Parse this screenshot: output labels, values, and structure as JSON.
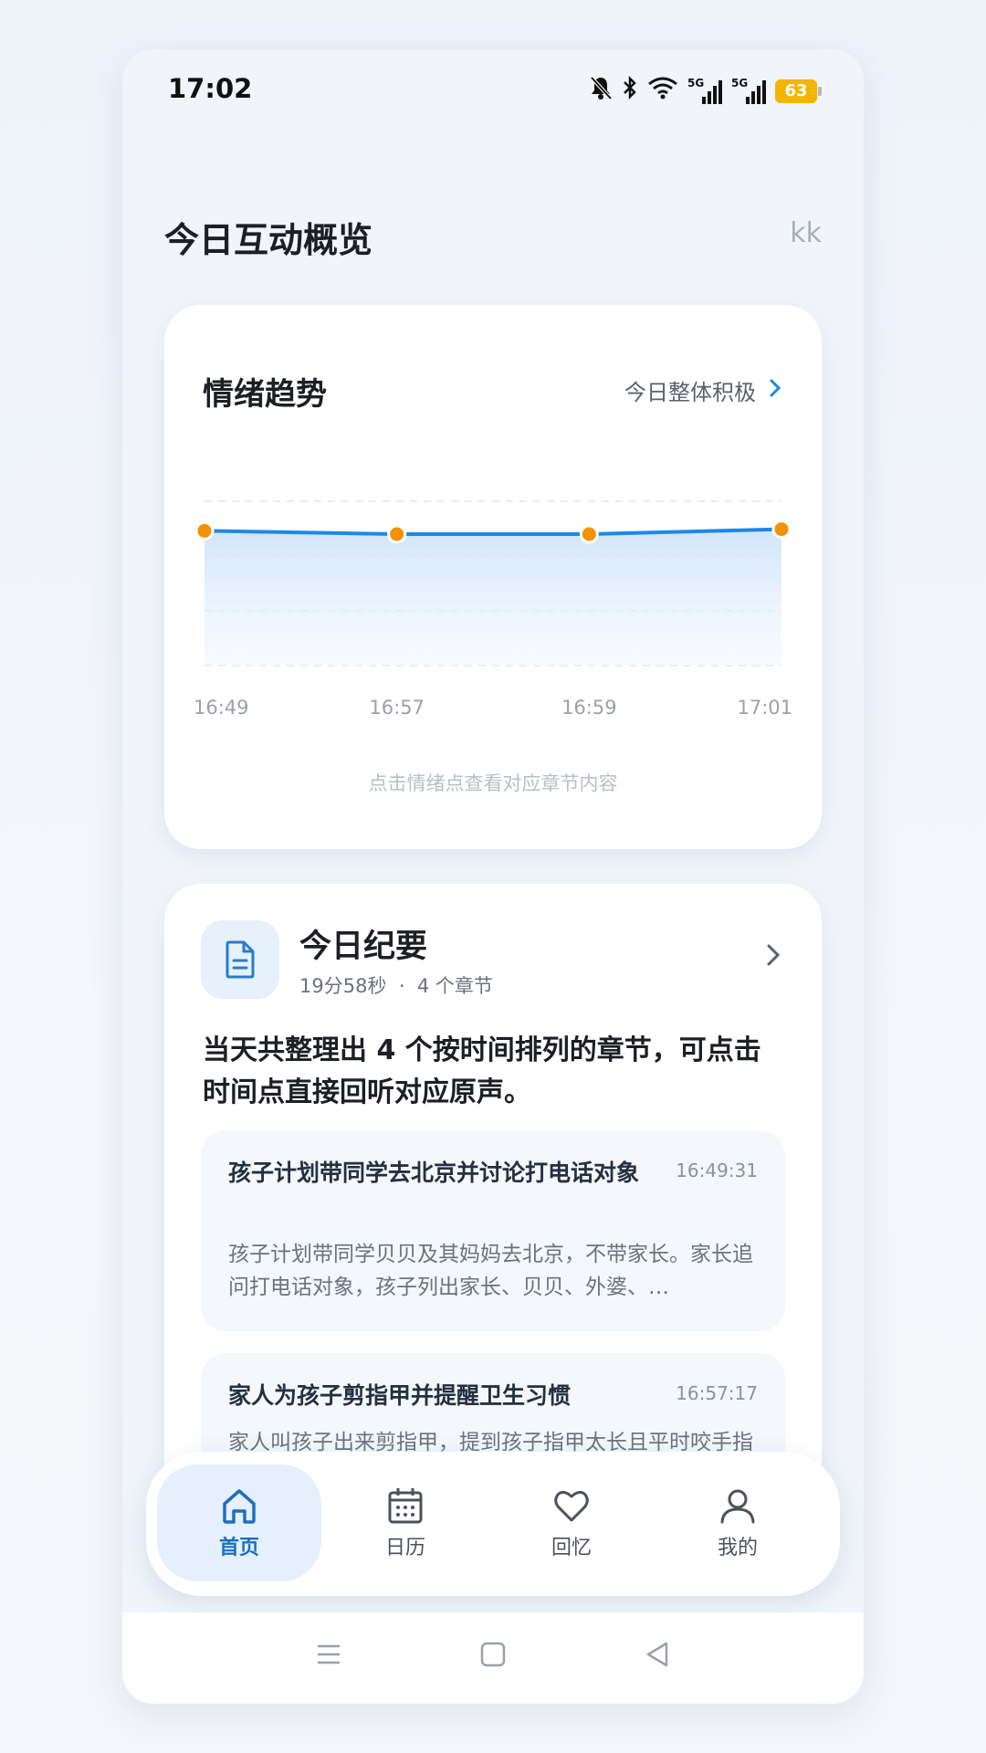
{
  "status_bar": {
    "time": "17:02",
    "battery": "63",
    "network_tag_1": "5G",
    "network_tag_2": "5G",
    "icons": [
      "bell-off-icon",
      "bluetooth-icon",
      "wifi-icon",
      "signal-5g-icon",
      "signal-5g-icon",
      "battery-icon"
    ]
  },
  "header": {
    "title": "今日互动概览",
    "user": "kk"
  },
  "mood_card": {
    "title": "情绪趋势",
    "summary": "今日整体积极",
    "hint": "点击情绪点查看对应章节内容",
    "line_color": "#1e88e5",
    "point_color": "#f39200"
  },
  "chart_data": {
    "type": "line",
    "x": [
      "16:49",
      "16:57",
      "16:59",
      "17:01"
    ],
    "series": [
      {
        "values": [
          0.82,
          0.8,
          0.8,
          0.83
        ]
      }
    ],
    "ylim": [
      0,
      1
    ],
    "grid": true
  },
  "summary_card": {
    "title": "今日纪要",
    "duration": "19分58秒",
    "separator": "·",
    "chapters_count": "4 个章节",
    "lead": "当天共整理出 4 个按时间排列的章节，可点击时间点直接回听对应原声。",
    "chapters": [
      {
        "title": "孩子计划带同学去北京并讨论打电话对象",
        "time": "16:49:31",
        "text": "孩子计划带同学贝贝及其妈妈去北京，不带家长。家长追问打电话对象，孩子列出家长、贝贝、外婆、…"
      },
      {
        "title": "家人为孩子剪指甲并提醒卫生习惯",
        "time": "16:57:17",
        "text": "家人叫孩子出来剪指甲，提到孩子指甲太长且平时咬手指没注意。孩子说以前都是妈妈剪，自己没注意…"
      }
    ]
  },
  "bottom_nav": {
    "items": [
      {
        "label": "首页",
        "icon": "home-icon",
        "active": true
      },
      {
        "label": "日历",
        "icon": "calendar-icon",
        "active": false
      },
      {
        "label": "回忆",
        "icon": "heart-icon",
        "active": false
      },
      {
        "label": "我的",
        "icon": "user-icon",
        "active": false
      }
    ],
    "accent": "#1e6fbd"
  },
  "system_nav": [
    "menu-icon",
    "home-square-icon",
    "back-triangle-icon"
  ]
}
